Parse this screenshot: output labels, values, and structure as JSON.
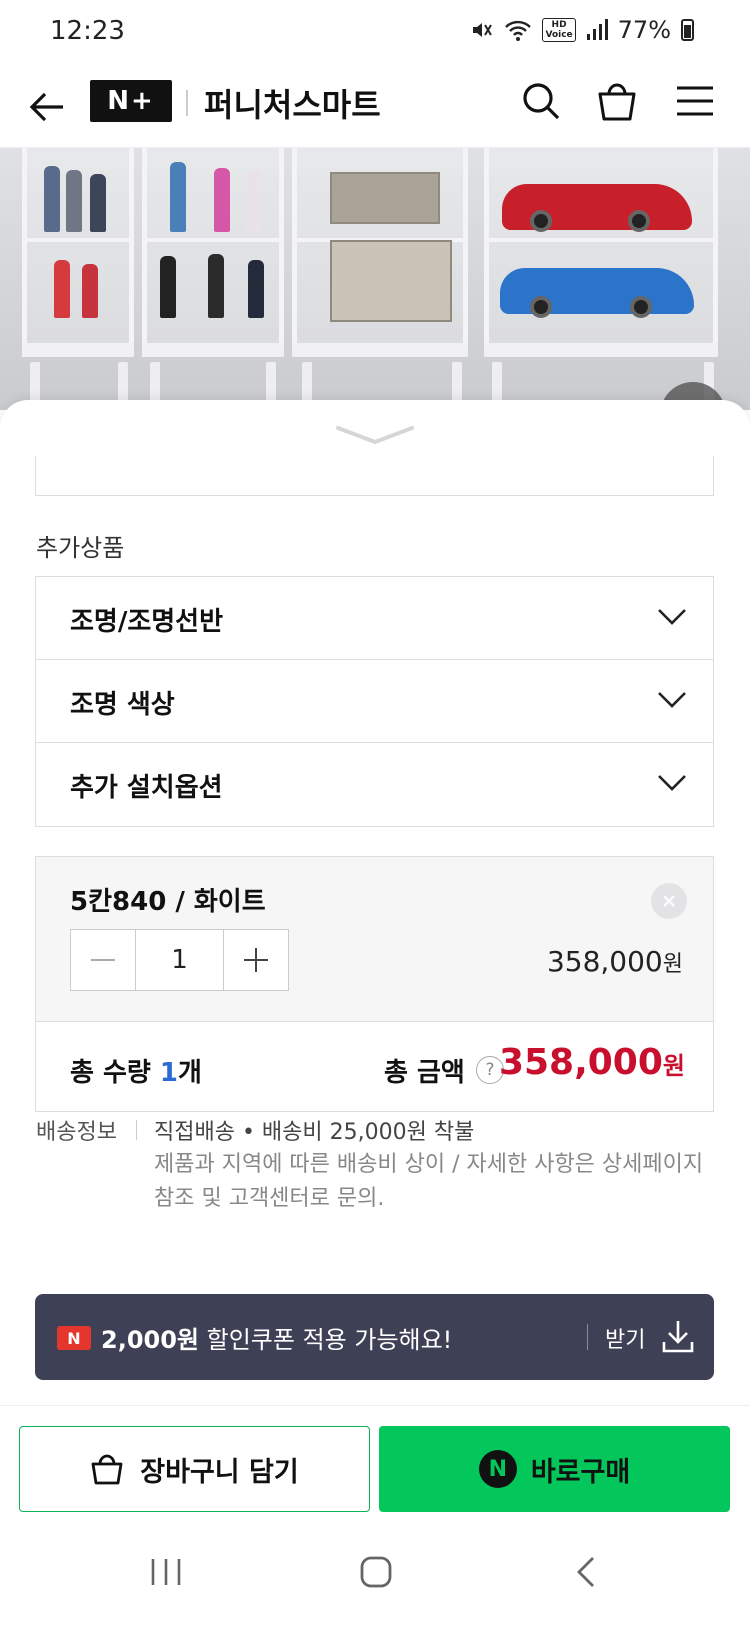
{
  "status_bar": {
    "time": "12:23",
    "hd_badge": "HD\nVoice",
    "battery": "77%"
  },
  "header": {
    "logo": "N+",
    "store_name": "퍼니처스마트",
    "icons": [
      "back-arrow-icon",
      "search-icon",
      "shopping-bag-icon",
      "menu-icon"
    ]
  },
  "additional_products": {
    "label": "추가상품",
    "items": [
      {
        "label": "조명/조명선반"
      },
      {
        "label": "조명 색상"
      },
      {
        "label": "추가 설치옵션"
      }
    ]
  },
  "selected_item": {
    "option": "5칸840 / 화이트",
    "quantity": "1",
    "price": "358,000",
    "currency": "원"
  },
  "total": {
    "qty_label": "총 수량 ",
    "qty_value": "1",
    "qty_unit": "개",
    "amount_label": "총 금액",
    "help": "?",
    "amount": "358,000",
    "currency": "원"
  },
  "shipping": {
    "label": "배송정보",
    "main": "직접배송 • 배송비 25,000원 착불",
    "note": "제품과 지역에 따른 배송비 상이 / 자세한 사항은 상세페이지 참조 및 고객센터로 문의."
  },
  "coupon": {
    "badge": "N",
    "amount": "2,000원",
    "text": " 할인쿠폰 적용 가능해요!",
    "get_label": "받기"
  },
  "buy_bar": {
    "cart_label": "장바구니 담기",
    "buy_label": "바로구매",
    "npay_badge": "N"
  },
  "colors": {
    "accent_green": "#03c75a",
    "price_red": "#c8102e",
    "coupon_bg": "#3e4055",
    "qty_blue": "#2b6ad4"
  }
}
